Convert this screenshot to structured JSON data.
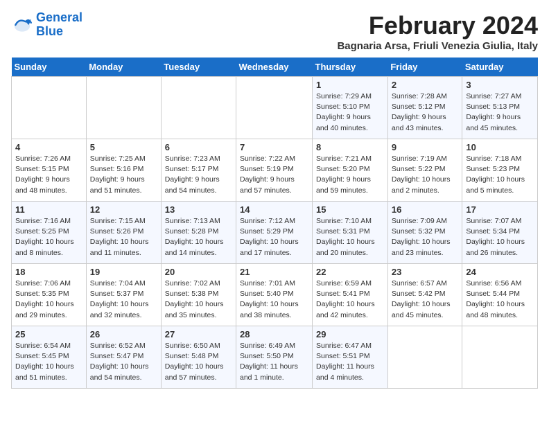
{
  "header": {
    "logo_line1": "General",
    "logo_line2": "Blue",
    "month": "February 2024",
    "location": "Bagnaria Arsa, Friuli Venezia Giulia, Italy"
  },
  "days_of_week": [
    "Sunday",
    "Monday",
    "Tuesday",
    "Wednesday",
    "Thursday",
    "Friday",
    "Saturday"
  ],
  "weeks": [
    [
      {
        "num": "",
        "info": ""
      },
      {
        "num": "",
        "info": ""
      },
      {
        "num": "",
        "info": ""
      },
      {
        "num": "",
        "info": ""
      },
      {
        "num": "1",
        "info": "Sunrise: 7:29 AM\nSunset: 5:10 PM\nDaylight: 9 hours\nand 40 minutes."
      },
      {
        "num": "2",
        "info": "Sunrise: 7:28 AM\nSunset: 5:12 PM\nDaylight: 9 hours\nand 43 minutes."
      },
      {
        "num": "3",
        "info": "Sunrise: 7:27 AM\nSunset: 5:13 PM\nDaylight: 9 hours\nand 45 minutes."
      }
    ],
    [
      {
        "num": "4",
        "info": "Sunrise: 7:26 AM\nSunset: 5:15 PM\nDaylight: 9 hours\nand 48 minutes."
      },
      {
        "num": "5",
        "info": "Sunrise: 7:25 AM\nSunset: 5:16 PM\nDaylight: 9 hours\nand 51 minutes."
      },
      {
        "num": "6",
        "info": "Sunrise: 7:23 AM\nSunset: 5:17 PM\nDaylight: 9 hours\nand 54 minutes."
      },
      {
        "num": "7",
        "info": "Sunrise: 7:22 AM\nSunset: 5:19 PM\nDaylight: 9 hours\nand 57 minutes."
      },
      {
        "num": "8",
        "info": "Sunrise: 7:21 AM\nSunset: 5:20 PM\nDaylight: 9 hours\nand 59 minutes."
      },
      {
        "num": "9",
        "info": "Sunrise: 7:19 AM\nSunset: 5:22 PM\nDaylight: 10 hours\nand 2 minutes."
      },
      {
        "num": "10",
        "info": "Sunrise: 7:18 AM\nSunset: 5:23 PM\nDaylight: 10 hours\nand 5 minutes."
      }
    ],
    [
      {
        "num": "11",
        "info": "Sunrise: 7:16 AM\nSunset: 5:25 PM\nDaylight: 10 hours\nand 8 minutes."
      },
      {
        "num": "12",
        "info": "Sunrise: 7:15 AM\nSunset: 5:26 PM\nDaylight: 10 hours\nand 11 minutes."
      },
      {
        "num": "13",
        "info": "Sunrise: 7:13 AM\nSunset: 5:28 PM\nDaylight: 10 hours\nand 14 minutes."
      },
      {
        "num": "14",
        "info": "Sunrise: 7:12 AM\nSunset: 5:29 PM\nDaylight: 10 hours\nand 17 minutes."
      },
      {
        "num": "15",
        "info": "Sunrise: 7:10 AM\nSunset: 5:31 PM\nDaylight: 10 hours\nand 20 minutes."
      },
      {
        "num": "16",
        "info": "Sunrise: 7:09 AM\nSunset: 5:32 PM\nDaylight: 10 hours\nand 23 minutes."
      },
      {
        "num": "17",
        "info": "Sunrise: 7:07 AM\nSunset: 5:34 PM\nDaylight: 10 hours\nand 26 minutes."
      }
    ],
    [
      {
        "num": "18",
        "info": "Sunrise: 7:06 AM\nSunset: 5:35 PM\nDaylight: 10 hours\nand 29 minutes."
      },
      {
        "num": "19",
        "info": "Sunrise: 7:04 AM\nSunset: 5:37 PM\nDaylight: 10 hours\nand 32 minutes."
      },
      {
        "num": "20",
        "info": "Sunrise: 7:02 AM\nSunset: 5:38 PM\nDaylight: 10 hours\nand 35 minutes."
      },
      {
        "num": "21",
        "info": "Sunrise: 7:01 AM\nSunset: 5:40 PM\nDaylight: 10 hours\nand 38 minutes."
      },
      {
        "num": "22",
        "info": "Sunrise: 6:59 AM\nSunset: 5:41 PM\nDaylight: 10 hours\nand 42 minutes."
      },
      {
        "num": "23",
        "info": "Sunrise: 6:57 AM\nSunset: 5:42 PM\nDaylight: 10 hours\nand 45 minutes."
      },
      {
        "num": "24",
        "info": "Sunrise: 6:56 AM\nSunset: 5:44 PM\nDaylight: 10 hours\nand 48 minutes."
      }
    ],
    [
      {
        "num": "25",
        "info": "Sunrise: 6:54 AM\nSunset: 5:45 PM\nDaylight: 10 hours\nand 51 minutes."
      },
      {
        "num": "26",
        "info": "Sunrise: 6:52 AM\nSunset: 5:47 PM\nDaylight: 10 hours\nand 54 minutes."
      },
      {
        "num": "27",
        "info": "Sunrise: 6:50 AM\nSunset: 5:48 PM\nDaylight: 10 hours\nand 57 minutes."
      },
      {
        "num": "28",
        "info": "Sunrise: 6:49 AM\nSunset: 5:50 PM\nDaylight: 11 hours\nand 1 minute."
      },
      {
        "num": "29",
        "info": "Sunrise: 6:47 AM\nSunset: 5:51 PM\nDaylight: 11 hours\nand 4 minutes."
      },
      {
        "num": "",
        "info": ""
      },
      {
        "num": "",
        "info": ""
      }
    ]
  ]
}
